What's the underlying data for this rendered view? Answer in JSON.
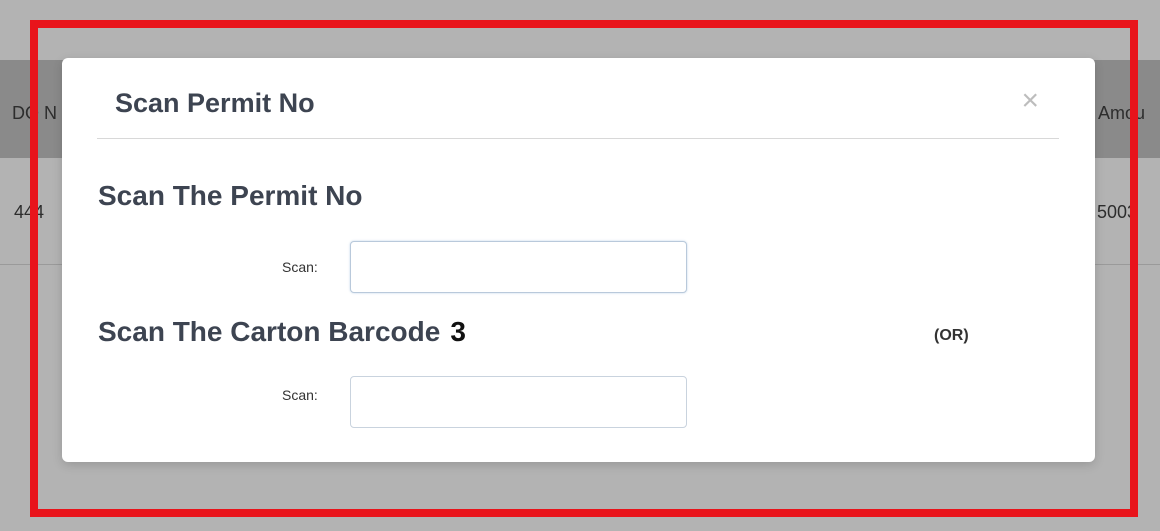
{
  "background_table": {
    "header_left": "DO N",
    "header_right": "Amou",
    "row_left": "444",
    "row_right": "5003"
  },
  "modal": {
    "title": "Scan Permit No",
    "close_symbol": "×",
    "permit_section_title": "Scan The Permit No",
    "permit_scan_label": "Scan:",
    "permit_input_value": "",
    "carton_section_title": "Scan The Carton Barcode",
    "carton_count": "3",
    "or_text": "(OR)",
    "carton_scan_label": "Scan:",
    "carton_input_value": ""
  },
  "colors": {
    "highlight_frame": "#e8141b",
    "overlay": "#b3b3b3",
    "title_text": "#3d4451"
  }
}
